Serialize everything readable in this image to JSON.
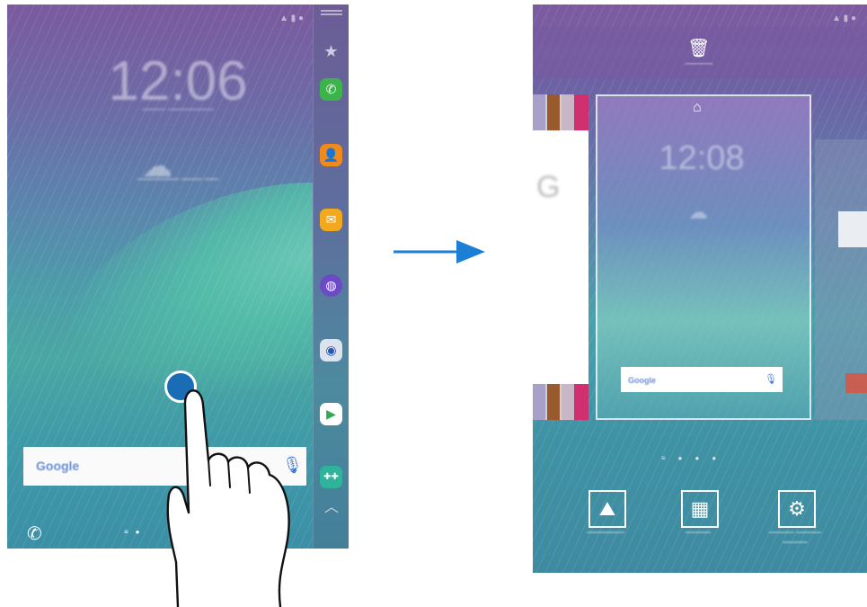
{
  "left_phone": {
    "time": "12:06",
    "dock_icons": [
      "phone-icon"
    ]
  },
  "edge_apps": [
    {
      "name": "star-icon",
      "color": "#6b7fa8"
    },
    {
      "name": "phone-app-icon",
      "color": "#3cb44b"
    },
    {
      "name": "contacts-app-icon",
      "color": "#f08a1c"
    },
    {
      "name": "email-app-icon",
      "color": "#f2a91e"
    },
    {
      "name": "internet-app-icon",
      "color": "#6a4bc4"
    },
    {
      "name": "camera-app-icon",
      "color": "#dce3ee"
    },
    {
      "name": "play-store-app-icon",
      "color": "#ffffff"
    },
    {
      "name": "apps-folder-icon",
      "color": "#2fb39a"
    }
  ],
  "right_phone": {
    "time": "12:08"
  },
  "colors": {
    "arrow": "#1c7fd6",
    "touch_point": "#1a6cb5"
  }
}
